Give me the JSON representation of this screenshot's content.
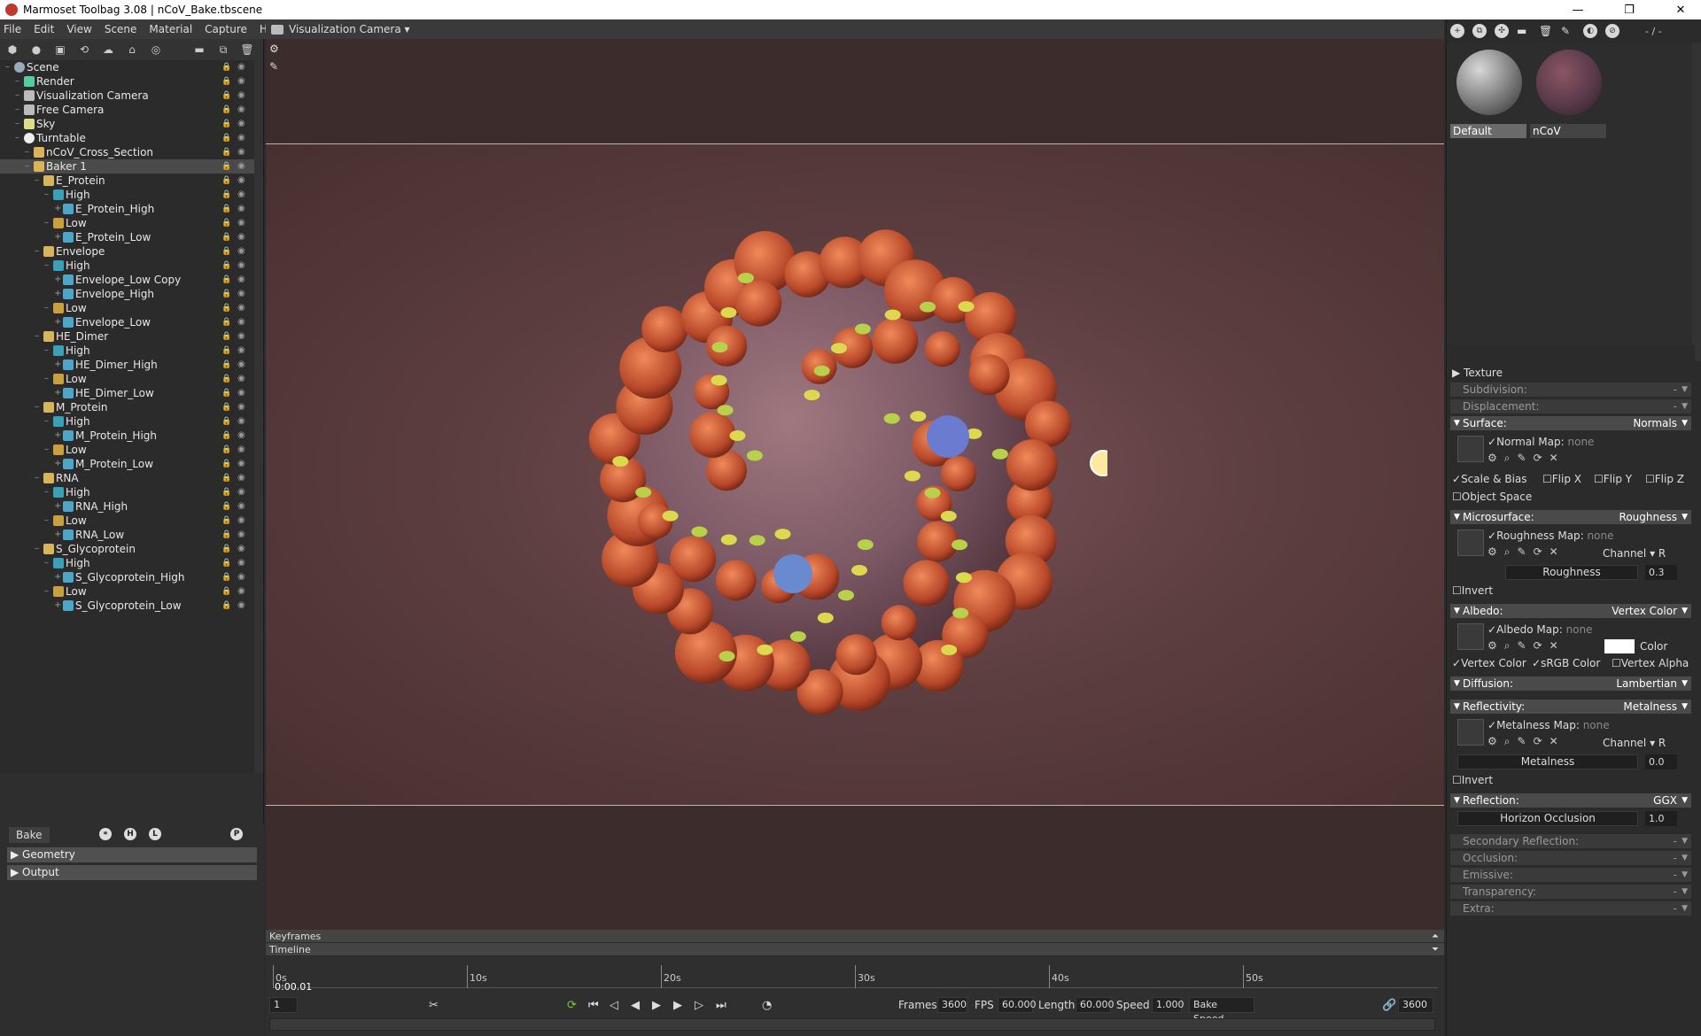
{
  "window": {
    "title": "Marmoset Toolbag 3.08  |  nCoV_Bake.tbscene",
    "minimize": "—",
    "restore": "❐",
    "close": "✕"
  },
  "menu": [
    "File",
    "Edit",
    "View",
    "Scene",
    "Material",
    "Capture",
    "Help"
  ],
  "viewport": {
    "camera": "Visualization Camera ▾"
  },
  "tree": [
    {
      "label": "Scene",
      "depth": 0,
      "icon": "scene"
    },
    {
      "label": "Render",
      "depth": 1,
      "icon": "render"
    },
    {
      "label": "Visualization Camera",
      "depth": 1,
      "icon": "cam"
    },
    {
      "label": "Free Camera",
      "depth": 1,
      "icon": "cam"
    },
    {
      "label": "Sky",
      "depth": 1,
      "icon": "sky"
    },
    {
      "label": "Turntable",
      "depth": 1,
      "icon": "turn"
    },
    {
      "label": "nCoV_Cross_Section",
      "depth": 2,
      "icon": "folder"
    },
    {
      "label": "Baker 1",
      "depth": 2,
      "icon": "folder",
      "selected": true
    },
    {
      "label": "E_Protein",
      "depth": 3,
      "icon": "folder"
    },
    {
      "label": "High",
      "depth": 4,
      "icon": "high"
    },
    {
      "label": "E_Protein_High",
      "depth": 5,
      "icon": "mesh"
    },
    {
      "label": "Low",
      "depth": 4,
      "icon": "low"
    },
    {
      "label": "E_Protein_Low",
      "depth": 5,
      "icon": "mesh"
    },
    {
      "label": "Envelope",
      "depth": 3,
      "icon": "folder"
    },
    {
      "label": "High",
      "depth": 4,
      "icon": "high"
    },
    {
      "label": "Envelope_Low Copy",
      "depth": 5,
      "icon": "mesh"
    },
    {
      "label": "Envelope_High",
      "depth": 5,
      "icon": "mesh"
    },
    {
      "label": "Low",
      "depth": 4,
      "icon": "low"
    },
    {
      "label": "Envelope_Low",
      "depth": 5,
      "icon": "mesh"
    },
    {
      "label": "HE_Dimer",
      "depth": 3,
      "icon": "folder"
    },
    {
      "label": "High",
      "depth": 4,
      "icon": "high"
    },
    {
      "label": "HE_Dimer_High",
      "depth": 5,
      "icon": "mesh"
    },
    {
      "label": "Low",
      "depth": 4,
      "icon": "low"
    },
    {
      "label": "HE_Dimer_Low",
      "depth": 5,
      "icon": "mesh"
    },
    {
      "label": "M_Protein",
      "depth": 3,
      "icon": "folder"
    },
    {
      "label": "High",
      "depth": 4,
      "icon": "high"
    },
    {
      "label": "M_Protein_High",
      "depth": 5,
      "icon": "mesh"
    },
    {
      "label": "Low",
      "depth": 4,
      "icon": "low"
    },
    {
      "label": "M_Protein_Low",
      "depth": 5,
      "icon": "mesh"
    },
    {
      "label": "RNA",
      "depth": 3,
      "icon": "folder"
    },
    {
      "label": "High",
      "depth": 4,
      "icon": "high"
    },
    {
      "label": "RNA_High",
      "depth": 5,
      "icon": "mesh"
    },
    {
      "label": "Low",
      "depth": 4,
      "icon": "low"
    },
    {
      "label": "RNA_Low",
      "depth": 5,
      "icon": "mesh"
    },
    {
      "label": "S_Glycoprotein",
      "depth": 3,
      "icon": "folder"
    },
    {
      "label": "High",
      "depth": 4,
      "icon": "high"
    },
    {
      "label": "S_Glycoprotein_High",
      "depth": 5,
      "icon": "mesh"
    },
    {
      "label": "Low",
      "depth": 4,
      "icon": "low"
    },
    {
      "label": "S_Glycoprotein_Low",
      "depth": 5,
      "icon": "mesh"
    }
  ],
  "bake": {
    "tab": "Bake",
    "btn_h": "H",
    "btn_l": "L",
    "btn_p": "P",
    "sections": [
      "Geometry",
      "Output"
    ]
  },
  "timeline": {
    "keyframes": "Keyframes",
    "timeline": "Timeline",
    "ticks": [
      "0s",
      "10s",
      "20s",
      "30s",
      "40s",
      "50s"
    ],
    "current_time": "0:00.01",
    "frame": "1",
    "frames_label": "Frames",
    "frames": "3600",
    "fps_label": "FPS",
    "fps": "60.000",
    "length_label": "Length",
    "length": "60.000",
    "speed_label": "Speed",
    "speed": "1.000",
    "bake_speed": "Bake Speed",
    "end_frame": "3600"
  },
  "materials": {
    "counter": "- / -",
    "items": [
      {
        "label": "Default",
        "selected": true
      },
      {
        "label": "nCoV",
        "selected": false
      }
    ]
  },
  "props": {
    "texture": "Texture",
    "subdivision": "Subdivision:",
    "displacement": "Displacement:",
    "dash": "-",
    "surface": "Surface:",
    "surface_val": "Normals",
    "normal_map": "Normal Map:",
    "none": "none",
    "scale_bias": "Scale & Bias",
    "flip_x": "Flip X",
    "flip_y": "Flip Y",
    "flip_z": "Flip Z",
    "object_space": "Object Space",
    "microsurface": "Microsurface:",
    "microsurface_val": "Roughness",
    "roughness_map": "Roughness Map:",
    "channel": "Channel",
    "channel_r": "R",
    "roughness": "Roughness",
    "roughness_val": "0.3",
    "invert": "Invert",
    "albedo": "Albedo:",
    "albedo_val": "Vertex Color",
    "albedo_map": "Albedo Map:",
    "color": "Color",
    "vertex_color": "Vertex Color",
    "srgb_color": "sRGB Color",
    "vertex_alpha": "Vertex Alpha",
    "diffusion": "Diffusion:",
    "diffusion_val": "Lambertian",
    "reflectivity": "Reflectivity:",
    "reflectivity_val": "Metalness",
    "metalness_map": "Metalness Map:",
    "metalness": "Metalness",
    "metalness_val": "0.0",
    "reflection": "Reflection:",
    "reflection_val": "GGX",
    "horizon_occlusion": "Horizon Occlusion",
    "horizon_val": "1.0",
    "secondary_reflection": "Secondary Reflection:",
    "occlusion": "Occlusion:",
    "emissive": "Emissive:",
    "transparency": "Transparency:",
    "extra": "Extra:"
  }
}
